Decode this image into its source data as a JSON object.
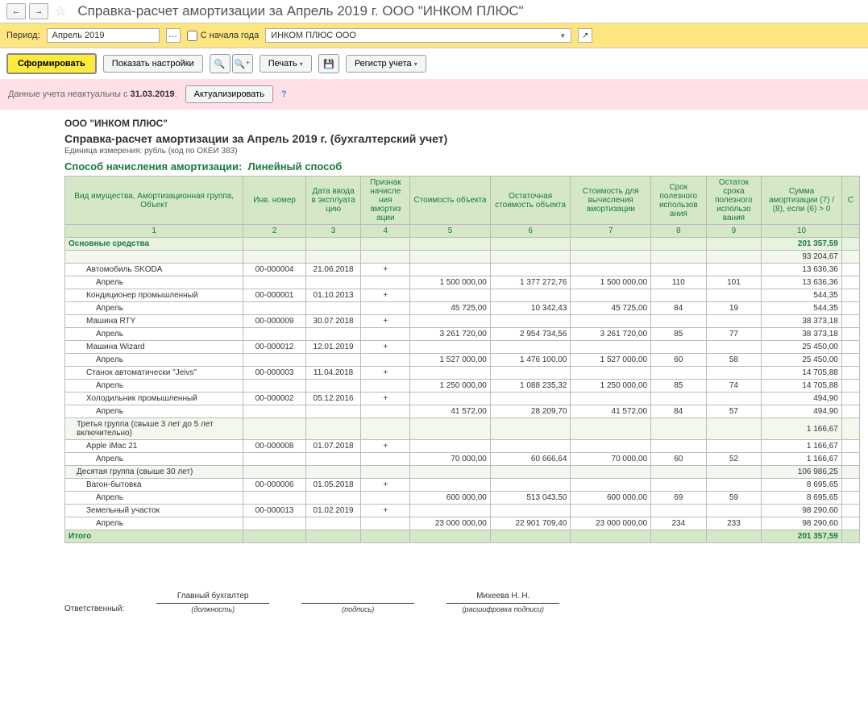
{
  "titlebar": {
    "title": "Справка-расчет амортизации за Апрель 2019 г. ООО \"ИНКОМ ПЛЮС\""
  },
  "period_bar": {
    "label": "Период:",
    "value": "Апрель 2019",
    "from_year_label": "С начала года",
    "org_value": "ИНКОМ ПЛЮС ООО"
  },
  "toolbar": {
    "form_btn": "Сформировать",
    "settings_btn": "Показать настройки",
    "print_btn": "Печать",
    "register_btn": "Регистр учета"
  },
  "warning": {
    "text_prefix": "Данные учета неактуальны с ",
    "date": "31.03.2019",
    "update_btn": "Актуализировать"
  },
  "report_header": {
    "org": "ООО \"ИНКОМ ПЛЮС\"",
    "title": "Справка-расчет амортизации за Апрель 2019 г. (бухгалтерский учет)",
    "unit": "Единица измерения:   рубль (код по ОКЕИ 383)",
    "method_label": "Способ начисления амортизации:",
    "method_value": "Линейный способ"
  },
  "columns": {
    "c1": "Вид имущества, Амортизационная группа, Объект",
    "c2": "Инв. номер",
    "c3": "Дата ввода в эксплуата цию",
    "c4": "Признак начисле ния амортиз ации",
    "c5": "Стоимость объекта",
    "c6": "Остаточная стоимость объекта",
    "c7": "Стоимость для вычисления амортизации",
    "c8": "Срок полезного использов ания",
    "c9": "Остаток срока полезного использо вания",
    "c10": "Сумма амортизации (7) / (8), если (6) > 0",
    "c11": "С"
  },
  "col_nums": [
    "1",
    "2",
    "3",
    "4",
    "5",
    "6",
    "7",
    "8",
    "9",
    "10"
  ],
  "rows": [
    {
      "type": "group",
      "name": "Основные средства",
      "c10": "201 357,59"
    },
    {
      "type": "sub",
      "name": "",
      "c10": "93 204,67"
    },
    {
      "type": "item",
      "name": "Автомобиль SKODA",
      "inv": "00-000004",
      "date": "21.06.2018",
      "flag": "+",
      "c10": "13 636,36"
    },
    {
      "type": "month",
      "name": "Апрель",
      "c5": "1 500 000,00",
      "c6": "1 377 272,76",
      "c7": "1 500 000,00",
      "c8": "110",
      "c9": "101",
      "c10": "13 636,36"
    },
    {
      "type": "item",
      "name": "Кондиционер промышленный",
      "inv": "00-000001",
      "date": "01.10.2013",
      "flag": "+",
      "c10": "544,35"
    },
    {
      "type": "month",
      "name": "Апрель",
      "c5": "45 725,00",
      "c6": "10 342,43",
      "c7": "45 725,00",
      "c8": "84",
      "c9": "19",
      "c10": "544,35"
    },
    {
      "type": "item",
      "name": "Машина RTY",
      "inv": "00-000009",
      "date": "30.07.2018",
      "flag": "+",
      "c10": "38 373,18"
    },
    {
      "type": "month",
      "name": "Апрель",
      "c5": "3 261 720,00",
      "c6": "2 954 734,56",
      "c7": "3 261 720,00",
      "c8": "85",
      "c9": "77",
      "c10": "38 373,18"
    },
    {
      "type": "item",
      "name": "Машина Wizard",
      "inv": "00-000012",
      "date": "12.01.2019",
      "flag": "+",
      "c10": "25 450,00"
    },
    {
      "type": "month",
      "name": "Апрель",
      "c5": "1 527 000,00",
      "c6": "1 476 100,00",
      "c7": "1 527 000,00",
      "c8": "60",
      "c9": "58",
      "c10": "25 450,00"
    },
    {
      "type": "item",
      "name": "Станок автоматически \"Jeivs\"",
      "inv": "00-000003",
      "date": "11.04.2018",
      "flag": "+",
      "c10": "14 705,88"
    },
    {
      "type": "month",
      "name": "Апрель",
      "c5": "1 250 000,00",
      "c6": "1 088 235,32",
      "c7": "1 250 000,00",
      "c8": "85",
      "c9": "74",
      "c10": "14 705,88"
    },
    {
      "type": "item",
      "name": "Холодильник промышленный",
      "inv": "00-000002",
      "date": "05.12.2016",
      "flag": "+",
      "c10": "494,90"
    },
    {
      "type": "month",
      "name": "Апрель",
      "c5": "41 572,00",
      "c6": "28 209,70",
      "c7": "41 572,00",
      "c8": "84",
      "c9": "57",
      "c10": "494,90"
    },
    {
      "type": "sub",
      "name": "Третья группа (свыше 3 лет до 5 лет включительно)",
      "c10": "1 166,67"
    },
    {
      "type": "item",
      "name": "Apple iMac 21",
      "inv": "00-000008",
      "date": "01.07.2018",
      "flag": "+",
      "c10": "1 166,67"
    },
    {
      "type": "month",
      "name": "Апрель",
      "c5": "70 000,00",
      "c6": "60 666,64",
      "c7": "70 000,00",
      "c8": "60",
      "c9": "52",
      "c10": "1 166,67"
    },
    {
      "type": "sub",
      "name": "Десятая группа (свыше 30 лет)",
      "c10": "106 986,25"
    },
    {
      "type": "item",
      "name": "Вагон-бытовка",
      "inv": "00-000006",
      "date": "01.05.2018",
      "flag": "+",
      "c10": "8 695,65"
    },
    {
      "type": "month",
      "name": "Апрель",
      "c5": "600 000,00",
      "c6": "513 043,50",
      "c7": "600 000,00",
      "c8": "69",
      "c9": "59",
      "c10": "8 695,65"
    },
    {
      "type": "item",
      "name": "Земельный участок",
      "inv": "00-000013",
      "date": "01.02.2019",
      "flag": "+",
      "c10": "98 290,60"
    },
    {
      "type": "month",
      "name": "Апрель",
      "c5": "23 000 000,00",
      "c6": "22 901 709,40",
      "c7": "23 000 000,00",
      "c8": "234",
      "c9": "233",
      "c10": "98 290,60"
    },
    {
      "type": "total",
      "name": "Итого",
      "c10": "201 357,59"
    }
  ],
  "signature": {
    "resp_label": "Ответственный:",
    "position": "Главный бухгалтер",
    "position_label": "(должность)",
    "sign_label": "(подпись)",
    "name": "Михеева Н. Н.",
    "name_label": "(расшифровка подписи)"
  }
}
